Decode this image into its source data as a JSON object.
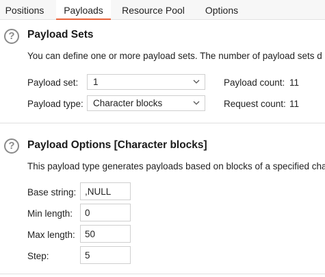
{
  "tabs": [
    {
      "label": "Positions"
    },
    {
      "label": "Payloads"
    },
    {
      "label": "Resource Pool"
    },
    {
      "label": "Options"
    }
  ],
  "active_tab": "Payloads",
  "payload_sets": {
    "title": "Payload Sets",
    "description": "You can define one or more payload sets. The number of payload sets d",
    "payload_set_label": "Payload set:",
    "payload_set_value": "1",
    "payload_type_label": "Payload type:",
    "payload_type_value": "Character blocks",
    "payload_count_label": "Payload count:",
    "payload_count_value": "11",
    "request_count_label": "Request count:",
    "request_count_value": "11"
  },
  "payload_options": {
    "title": "Payload Options [Character blocks]",
    "description": "This payload type generates payloads based on blocks of a specified cha",
    "base_string_label": "Base string:",
    "base_string_value": ",NULL",
    "min_length_label": "Min length:",
    "min_length_value": "0",
    "max_length_label": "Max length:",
    "max_length_value": "50",
    "step_label": "Step:",
    "step_value": "5"
  },
  "icons": {
    "help": "question-circle-icon",
    "dropdown": "chevron-down-icon"
  },
  "colors": {
    "accent": "#e8623a"
  }
}
